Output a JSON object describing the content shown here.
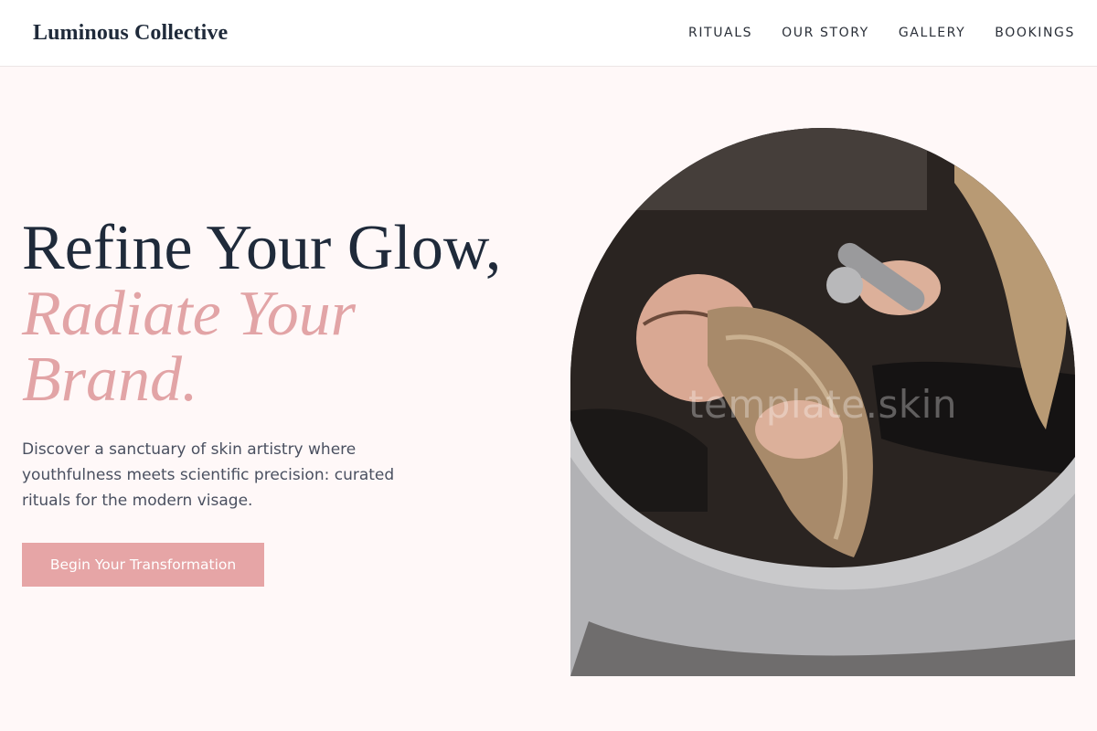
{
  "header": {
    "brand": "Luminous Collective",
    "nav": [
      {
        "label": "RITUALS"
      },
      {
        "label": "OUR STORY"
      },
      {
        "label": "GALLERY"
      },
      {
        "label": "BOOKINGS"
      }
    ]
  },
  "hero": {
    "title_line1": "Refine Your Glow,",
    "title_accent": "Radiate Your Brand.",
    "description": "Discover a sanctuary of skin artistry where youthfulness meets scientific precision: curated rituals for the modern visage.",
    "cta_label": "Begin Your Transformation",
    "image_watermark": "template.skin"
  },
  "colors": {
    "background": "#fff8f8",
    "accent": "#e6a5a6",
    "title": "#1f2a3a",
    "body_text": "#4a5060"
  }
}
